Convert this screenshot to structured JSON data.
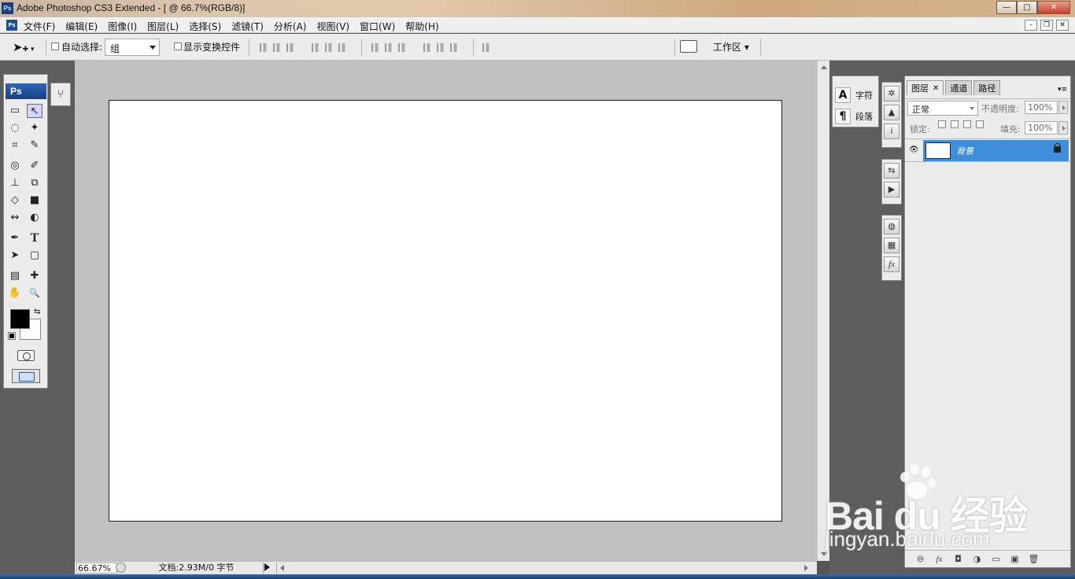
{
  "window": {
    "app_icon": "Ps",
    "title": "Adobe Photoshop CS3 Extended - [ @ 66.7%(RGB/8)]",
    "minimize": "—",
    "maximize": "□",
    "close": "✕"
  },
  "menubar": {
    "items": [
      "文件(F)",
      "编辑(E)",
      "图像(I)",
      "图层(L)",
      "选择(S)",
      "滤镜(T)",
      "分析(A)",
      "视图(V)",
      "窗口(W)",
      "帮助(H)"
    ],
    "mdi_minimize": "–",
    "mdi_restore": "❐",
    "mdi_close": "✕"
  },
  "options": {
    "auto_select_label": "自动选择:",
    "auto_select_value": "组",
    "show_transform_label": "显示变换控件",
    "workspace_label": "工作区 ▾"
  },
  "toolbox": {
    "badge": "Ps",
    "tools": [
      "▭",
      "↖",
      "◌",
      "✦",
      "⌗",
      "✎",
      "◎",
      "✐",
      "⊥",
      "⧉",
      "◇",
      "■",
      "↭",
      "◐",
      "✒",
      "T",
      "➤",
      "▢",
      "▤",
      "✚",
      "✋",
      "🔍"
    ]
  },
  "status": {
    "zoom": "66.67%",
    "doc_info": "文档:2.93M/0 字节"
  },
  "panels": {
    "char_label": "字符",
    "para_label": "段落",
    "char_icon": "A",
    "para_icon": "¶",
    "icon_group1": [
      "✲",
      "▲",
      "i"
    ],
    "icon_group2": [
      "⇆",
      "▶"
    ],
    "icon_group3": [
      "◍",
      "▦",
      "fx"
    ]
  },
  "layers_panel": {
    "tabs": [
      "图层",
      "通道",
      "路径"
    ],
    "blend_mode": "正常",
    "opacity_label": "不透明度:",
    "opacity_value": "100%",
    "lock_label": "锁定:",
    "fill_label": "填充:",
    "fill_value": "100%",
    "layer_name": "背景",
    "footer_icons": [
      "⊖",
      "fx",
      "◘",
      "◑",
      "▭",
      "▣",
      "🗑"
    ]
  },
  "watermark": {
    "brand": "Bai du 经验",
    "url": "jingyan.baidu.com"
  }
}
